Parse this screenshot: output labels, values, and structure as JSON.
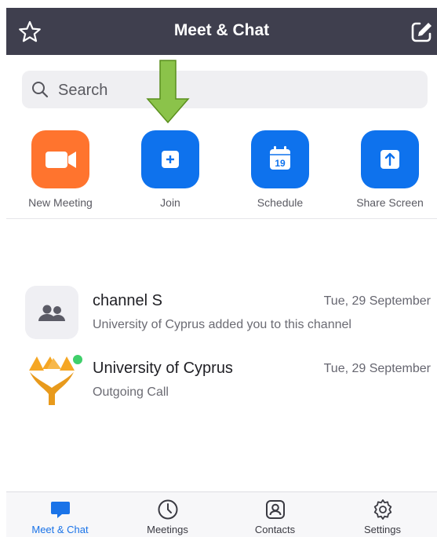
{
  "header": {
    "title": "Meet & Chat"
  },
  "search": {
    "placeholder": "Search"
  },
  "actions": [
    {
      "label": "New Meeting",
      "color": "#ff742e"
    },
    {
      "label": "Join",
      "color": "#0e72ed"
    },
    {
      "label": "Schedule",
      "color": "#0e72ed",
      "calendar_day": "19"
    },
    {
      "label": "Share Screen",
      "color": "#0e72ed"
    }
  ],
  "annotation": {
    "arrow_color": "#8bc34a",
    "arrow_stroke": "#5b8f1e"
  },
  "chats": [
    {
      "name": "channel S",
      "date": "Tue, 29 September",
      "subtitle": "University of Cyprus added you to this channel",
      "avatar": "people-icon"
    },
    {
      "name": "University of Cyprus",
      "date": "Tue, 29 September",
      "subtitle": "Outgoing Call",
      "avatar": "university-logo",
      "online": true
    }
  ],
  "nav": [
    {
      "label": "Meet & Chat",
      "icon": "chat-bubble-icon",
      "active": true
    },
    {
      "label": "Meetings",
      "icon": "clock-icon"
    },
    {
      "label": "Contacts",
      "icon": "contact-icon"
    },
    {
      "label": "Settings",
      "icon": "gear-icon"
    }
  ],
  "colors": {
    "header_bg": "#3f3f4e",
    "accent": "#1a73e8",
    "online": "#3fcf6a"
  }
}
